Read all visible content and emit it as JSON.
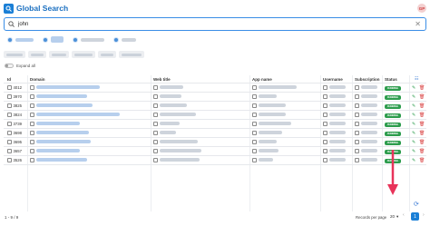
{
  "app": {
    "title": "Global Search",
    "avatar_initials": "GP"
  },
  "search": {
    "value": "john",
    "clear_icon": "close-icon"
  },
  "expand_all_label": "Expand all",
  "table": {
    "columns": [
      "Id",
      "Domain",
      "Web title",
      "App name",
      "Username",
      "Subscription",
      "Status"
    ],
    "rows": [
      {
        "id": "4012",
        "status": "RUNNING"
      },
      {
        "id": "3970",
        "status": "RUNNING"
      },
      {
        "id": "3825",
        "status": "RUNNING"
      },
      {
        "id": "3824",
        "status": "RUNNING"
      },
      {
        "id": "3739",
        "status": "RUNNING"
      },
      {
        "id": "3698",
        "status": "RUNNING"
      },
      {
        "id": "3695",
        "status": "RUNNING"
      },
      {
        "id": "3657",
        "status": "RUNNING"
      },
      {
        "id": "3526",
        "status": "RUNNING"
      }
    ]
  },
  "pagination": {
    "count_text": "1 - 9 / 9",
    "records_per_page_label": "Records per page",
    "records_per_page": "20",
    "current_page": "1"
  },
  "colors": {
    "accent": "#1a7fd6",
    "status_running": "#2e9d4e",
    "annotation_arrow": "#e8335a"
  }
}
